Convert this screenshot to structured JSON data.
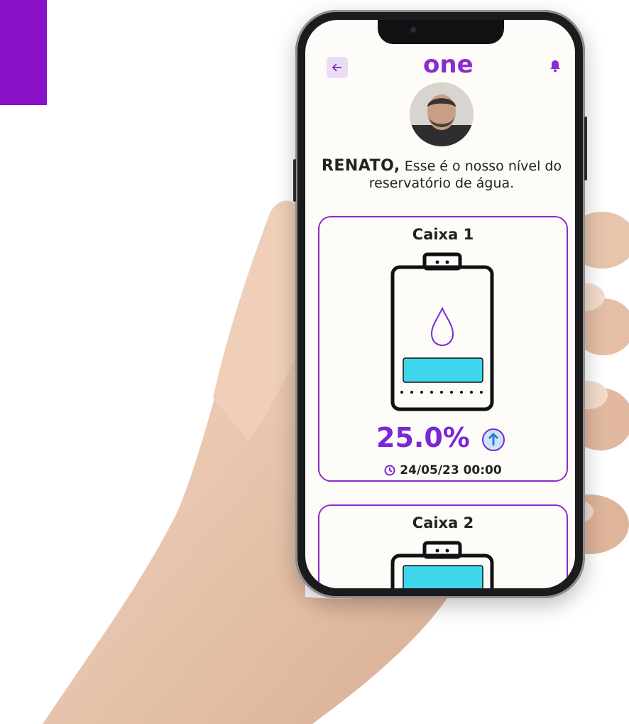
{
  "header": {
    "back_icon": "arrow-left-icon",
    "logo_text": "one",
    "bell_icon": "bell-icon"
  },
  "colors": {
    "brand_purple": "#8b2ccd",
    "percent_purple": "#7a27d6",
    "water": "#3dd6ea",
    "corner_block": "#8a12c8"
  },
  "greeting": {
    "name": "RENATO,",
    "line": "Esse é o nosso nível do reservatório de água."
  },
  "tanks": [
    {
      "title": "Caixa 1",
      "level_percent": 25.0,
      "level_label": "25.0%",
      "trend_icon": "arrow-up-circle-icon",
      "timestamp": "24/05/23 00:00"
    },
    {
      "title": "Caixa 2"
    }
  ]
}
